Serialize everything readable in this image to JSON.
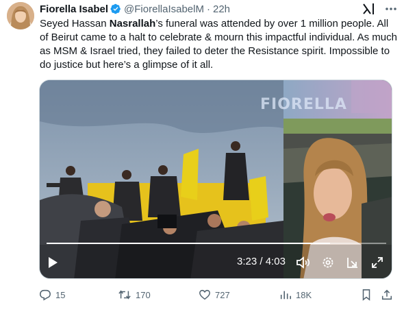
{
  "tweet": {
    "author_name": "Fiorella Isabel",
    "handle": "@FiorellaIsabelM",
    "separator": "·",
    "time": "22h",
    "text_segments": [
      "Seyed Hassan ",
      "Nasrallah",
      "’s funeral was attended by over 1 million people. All of Beirut came to a halt to celebrate & mourn this impactful individual. As much as MSM & Israel tried, they failed to deter the Resistance spirit. Impossible to do justice but here’s a glimpse of it all."
    ]
  },
  "video": {
    "watermark": "FIORELLA",
    "current_time": "3:23",
    "time_separator": "/",
    "duration": "4:03",
    "progress_fraction": 0.835
  },
  "actions": {
    "replies": "15",
    "reposts": "170",
    "likes": "727",
    "views": "18K"
  },
  "icons": {
    "verified": "verified-badge-icon",
    "grok": "grok-icon",
    "more": "more-icon",
    "play": "play-icon",
    "volume": "volume-icon",
    "settings": "settings-icon",
    "pip": "picture-in-picture-icon",
    "fullscreen": "fullscreen-icon",
    "reply": "reply-icon",
    "repost": "repost-icon",
    "like": "like-icon",
    "views": "views-icon",
    "bookmark": "bookmark-icon",
    "share": "share-icon"
  },
  "colors": {
    "verified": "#1d9bf0",
    "secondary_text": "#536471",
    "primary_text": "#0f1419",
    "flag_yellow": "#e8cf1a"
  }
}
